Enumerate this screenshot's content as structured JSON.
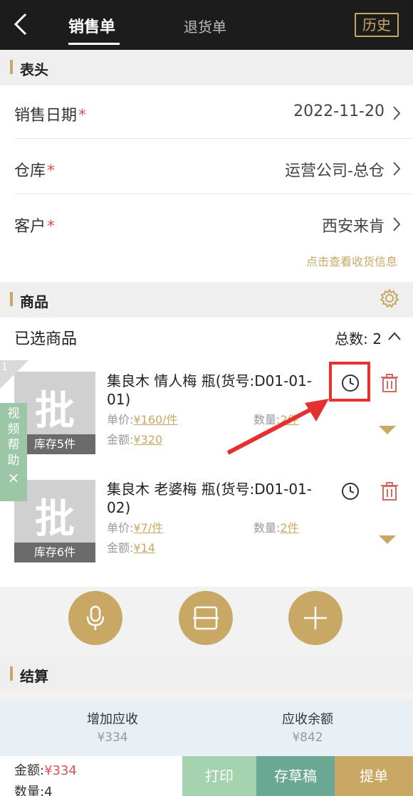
{
  "header": {
    "tab_sales": "销售单",
    "tab_return": "退货单",
    "history": "历史"
  },
  "sections": {
    "header_title": "表头",
    "products_title": "商品",
    "settle_title": "结算"
  },
  "form": {
    "date_label": "销售日期",
    "date_value": "2022-11-20",
    "warehouse_label": "仓库",
    "warehouse_value": "运营公司-总仓",
    "customer_label": "客户",
    "customer_value": "西安来肯",
    "required_mark": "*",
    "shipping_link": "点击查看收货信息"
  },
  "products": {
    "selected_label": "已选商品",
    "total_count_label": "总数:",
    "total_count": "2",
    "corner_number": "1",
    "items": [
      {
        "thumb_char": "批",
        "stock": "库存5件",
        "name": "集良木 情人梅 瓶(货号:D01-01-01)",
        "price_label": "单价:",
        "price": "¥160/件",
        "qty_label": "数量:",
        "qty": "2件",
        "amount_label": "金额:",
        "amount": "¥320"
      },
      {
        "thumb_char": "批",
        "stock": "库存6件",
        "name": "集良木 老婆梅 瓶(货号:D01-01-02)",
        "price_label": "单价:",
        "price": "¥7/件",
        "qty_label": "数量:",
        "qty": "2件",
        "amount_label": "金额:",
        "amount": "¥14"
      }
    ]
  },
  "video_help": {
    "text": "视频帮助",
    "close": "×"
  },
  "settlement": {
    "receivable_label": "增加应收",
    "receivable_value": "¥334",
    "balance_label": "应收余额",
    "balance_value": "¥842"
  },
  "footer": {
    "amount_label": "金额:",
    "amount_value": "¥334",
    "qty_label": "数量:4",
    "print": "打印",
    "draft": "存草稿",
    "submit": "提单"
  },
  "colors": {
    "accent": "#c8a864",
    "highlight": "#e53030",
    "print_bg": "#a5d3b0",
    "draft_bg": "#6aa893",
    "submit_bg": "#c8a864"
  }
}
